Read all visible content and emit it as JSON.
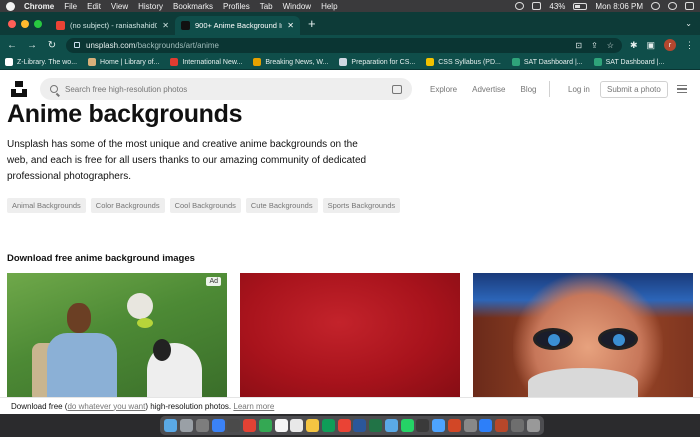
{
  "menubar": {
    "app": "Chrome",
    "items": [
      "File",
      "Edit",
      "View",
      "History",
      "Bookmarks",
      "Profiles",
      "Tab",
      "Window",
      "Help"
    ],
    "battery": "43%",
    "clock": "Mon 8:06 PM"
  },
  "tabs": [
    {
      "title": "(no subject) - raniashahid09@",
      "favicon_color": "#ea4335",
      "active": false
    },
    {
      "title": "900+ Anime Background Imag",
      "favicon_color": "#111111",
      "active": true
    }
  ],
  "toolbar": {
    "url_host": "unsplash.com",
    "url_path": "/backgrounds/art/anime",
    "profile_initial": "r"
  },
  "bookmarks": [
    {
      "label": "Z-Library. The wo...",
      "color": "#ffffff"
    },
    {
      "label": "Home | Library of...",
      "color": "#d8b07a"
    },
    {
      "label": "International New...",
      "color": "#e03c31"
    },
    {
      "label": "Breaking News, W...",
      "color": "#e6a100"
    },
    {
      "label": "Preparation for CS...",
      "color": "#cfd8e3"
    },
    {
      "label": "CSS Syllabus (PD...",
      "color": "#f2c200"
    },
    {
      "label": "SAT Dashboard |...",
      "color": "#2fa37a"
    },
    {
      "label": "SAT Dashboard |...",
      "color": "#2fa37a"
    }
  ],
  "site": {
    "search_placeholder": "Search free high-resolution photos",
    "nav": [
      "Explore",
      "Advertise",
      "Blog"
    ],
    "login": "Log in",
    "submit": "Submit a photo",
    "title": "Anime backgrounds",
    "description": "Unsplash has some of the most unique and creative anime backgrounds on the web, and each is free for all users thanks to our amazing community of dedicated professional photographers.",
    "chips": [
      "Animal Backgrounds",
      "Color Backgrounds",
      "Cool Backgrounds",
      "Cute Backgrounds",
      "Sports Backgrounds"
    ],
    "section_title": "Download free anime background images",
    "ad_badge": "Ad",
    "cookie_prefix": "Download free (",
    "cookie_link": "do whatever you want",
    "cookie_middle": ") high-resolution photos.",
    "cookie_learn": "Learn more"
  },
  "dock": {
    "icon_colors": [
      "#5aa9e6",
      "#9aa0a6",
      "#7d7d7d",
      "#3b82f6",
      "#4a4a4a",
      "#e34234",
      "#34a853",
      "#f5f5f5",
      "#e8e8e8",
      "#f5c542",
      "#0f9d58",
      "#ea4335",
      "#2b579a",
      "#217346",
      "#5aa9e6",
      "#25d366",
      "#3a3a3a",
      "#4da3ff",
      "#d24726",
      "#888888",
      "#2d7ff9",
      "#b7472a",
      "#6e6e6e",
      "#999999"
    ]
  }
}
